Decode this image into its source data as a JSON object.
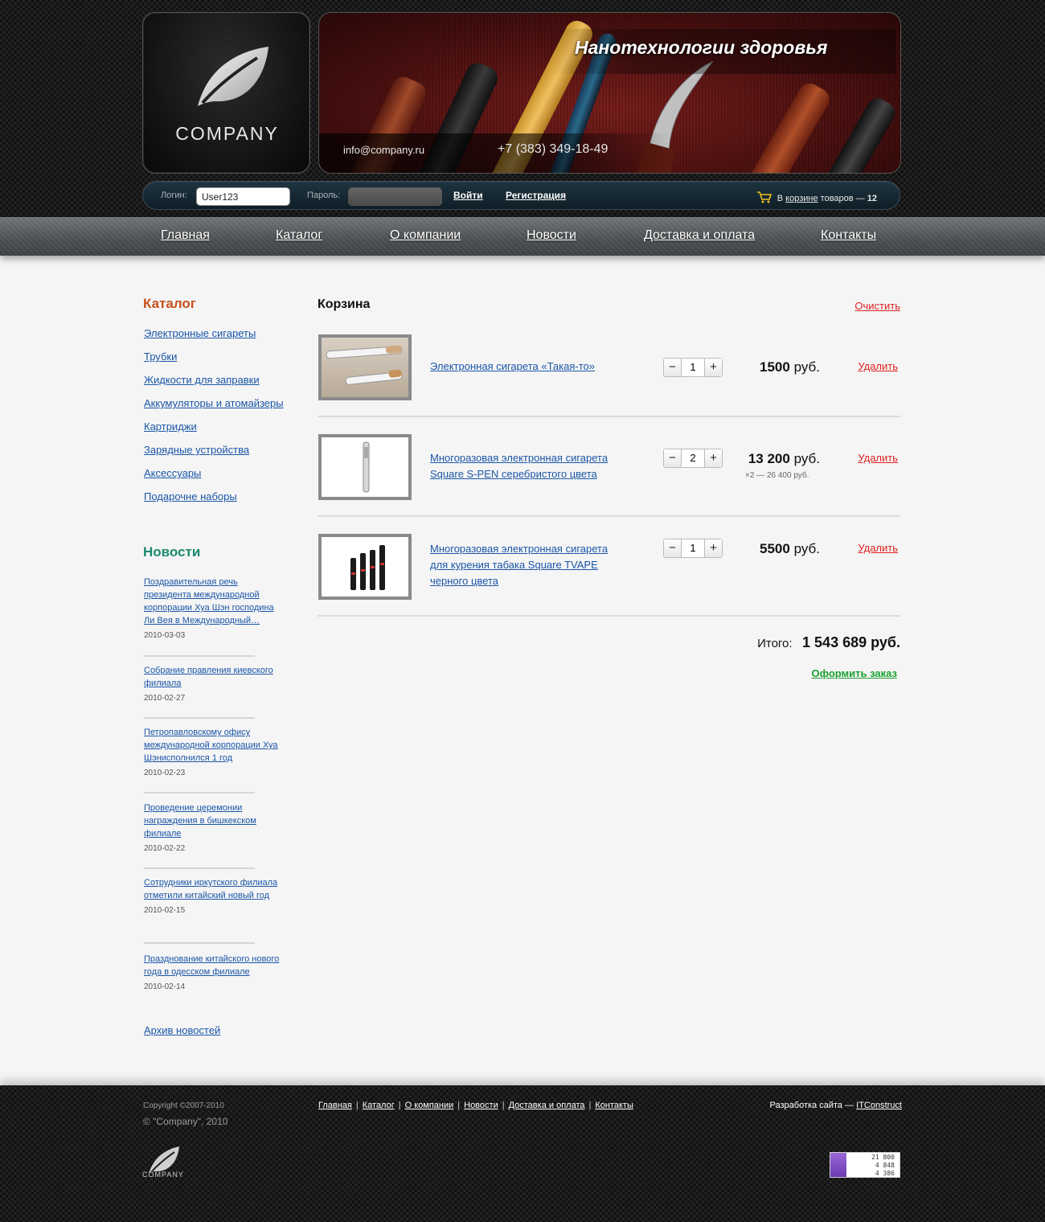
{
  "header": {
    "logo_text": "COMPANY",
    "slogan": "Нанотехнологии здоровья",
    "email": "info@company.ru",
    "phone": "+7 (383) 349-18-49"
  },
  "login": {
    "login_label": "Логин:",
    "login_value": "User123",
    "password_label": "Пароль:",
    "login_button": "Войти",
    "register_link": "Регистрация",
    "cart_prefix": "В",
    "cart_link": "корзине",
    "cart_middle": "товаров —",
    "cart_count": "12"
  },
  "nav": {
    "items": [
      "Главная",
      "Каталог",
      "О компании",
      "Новости",
      "Доставка и оплата",
      "Контакты"
    ]
  },
  "sidebar": {
    "catalog_title": "Каталог",
    "catalog": [
      "Электронные сигареты",
      "Трубки",
      "Жидкости для заправки",
      "Аккумуляторы и атомайзеры",
      "Картриджи",
      "Зарядные устройства",
      "Аксессуары",
      "Подарочне наборы"
    ],
    "news_title": "Новости",
    "news": [
      {
        "title": "Поздравительная речь президента международной корпорации Хуа Шэн господина Ли Вея в Международный…",
        "date": "2010-03-03"
      },
      {
        "title": "Собрание правления киевского филиала",
        "date": "2010-02-27"
      },
      {
        "title": "Петропавловскому офису международной корпорации Хуа Шэнисполнился 1 год",
        "date": "2010-02-23"
      },
      {
        "title": "Проведение церемонии награждения в бишкекском филиале",
        "date": "2010-02-22"
      },
      {
        "title": "Сотрудники иркутского филиала отметили китайский новый год",
        "date": "2010-02-15"
      },
      {
        "title": "Празднование китайского нового года в одесском филиале",
        "date": "2010-02-14"
      }
    ],
    "news_archive": "Архив новостей"
  },
  "cart": {
    "title": "Корзина",
    "clear": "Очистить",
    "items": [
      {
        "name": "Электронная сигарета «Такая-то»",
        "qty": "1",
        "price_value": "1500",
        "price_unit": "руб.",
        "subtotal": "",
        "delete": "Удалить"
      },
      {
        "name": "Многоразовая электронная сигарета Square S-PEN серебристого цвета",
        "qty": "2",
        "price_value": "13 200",
        "price_unit": "руб.",
        "subtotal": "×2 — 26 400 руб.",
        "delete": "Удалить"
      },
      {
        "name": "Многоразовая электронная сигарета для курения табака Square TVAPE черного цвета",
        "qty": "1",
        "price_value": "5500",
        "price_unit": "руб.",
        "subtotal": "",
        "delete": "Удалить"
      }
    ],
    "qty_minus": "−",
    "qty_plus": "+",
    "total_label": "Итого:",
    "total_value": "1 543 689 руб.",
    "order_button": "Оформить заказ"
  },
  "footer": {
    "copyright_line1": "Copyright ©2007-2010",
    "copyright_line2": "© \"Company\", 2010",
    "logo_text": "COMPANY",
    "nav": [
      "Главная",
      "Каталог",
      "О компании",
      "Новости",
      "Доставка и оплата",
      "Контакты"
    ],
    "nav_separator": "|",
    "dev_prefix": "Разработка сайта —",
    "dev_link": "ITConstruct",
    "counter": [
      "21 800",
      "4 848",
      "4 386"
    ]
  },
  "colors": {
    "accent_orange": "#c4501a",
    "news_green": "#1b8a6e",
    "link_blue": "#1a56a8",
    "delete_red": "#e02020",
    "order_green": "#1aa032"
  }
}
